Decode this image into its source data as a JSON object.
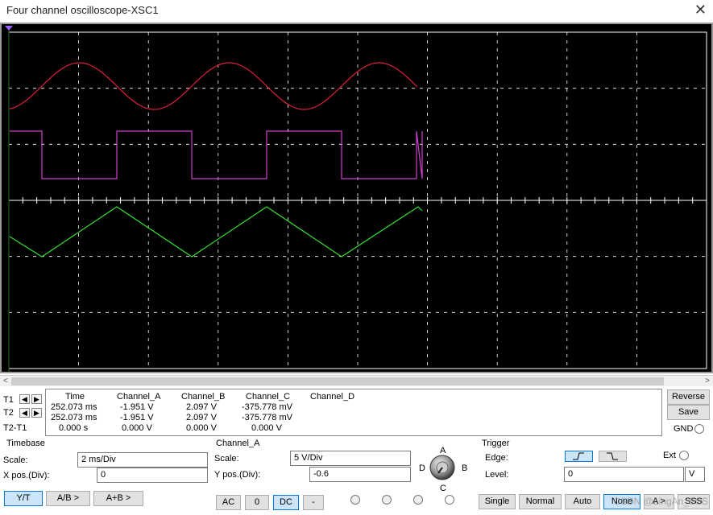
{
  "window": {
    "title": "Four channel oscilloscope-XSC1",
    "close_glyph": "✕"
  },
  "scrollbar": {
    "left_arrow": "<",
    "right_arrow": ">"
  },
  "readout": {
    "t1_label": "T1",
    "t2_label": "T2",
    "t2t1_label": "T2-T1",
    "headers": [
      "Time",
      "Channel_A",
      "Channel_B",
      "Channel_C",
      "Channel_D"
    ],
    "rows": [
      [
        "252.073 ms",
        "-1.951 V",
        "2.097 V",
        "-375.778 mV",
        ""
      ],
      [
        "252.073 ms",
        "-1.951 V",
        "2.097 V",
        "-375.778 mV",
        ""
      ],
      [
        "0.000 s",
        "0.000 V",
        "0.000 V",
        "0.000 V",
        ""
      ]
    ],
    "arrow_left": "◀",
    "arrow_right": "▶"
  },
  "side_buttons": {
    "reverse": "Reverse",
    "save": "Save",
    "gnd": "GND"
  },
  "timebase": {
    "title": "Timebase",
    "scale_label": "Scale:",
    "scale_value": "2 ms/Div",
    "xpos_label": "X pos.(Div):",
    "xpos_value": "0",
    "modes": [
      "Y/T",
      "A/B >",
      "A+B >"
    ]
  },
  "channel": {
    "title": "Channel_A",
    "scale_label": "Scale:",
    "scale_value": "5  V/Div",
    "ypos_label": "Y pos.(Div):",
    "ypos_value": "-0.6",
    "coupling": [
      "AC",
      "0",
      "DC",
      "-"
    ],
    "knob_labels": {
      "a": "A",
      "b": "B",
      "c": "C",
      "d": "D"
    }
  },
  "trigger": {
    "title": "Trigger",
    "edge_label": "Edge:",
    "ext_label": "Ext",
    "level_label": "Level:",
    "level_value": "0",
    "level_unit": "V",
    "modes": [
      "Single",
      "Normal",
      "Auto",
      "None",
      "A >",
      "SSS"
    ]
  },
  "watermark": "CSDN @LingAn_SSS",
  "colors": {
    "channel_a": "#e0203a",
    "channel_b": "#d040d0",
    "channel_c": "#30e030",
    "grid": "#ffffff",
    "screen": "#000000"
  }
}
